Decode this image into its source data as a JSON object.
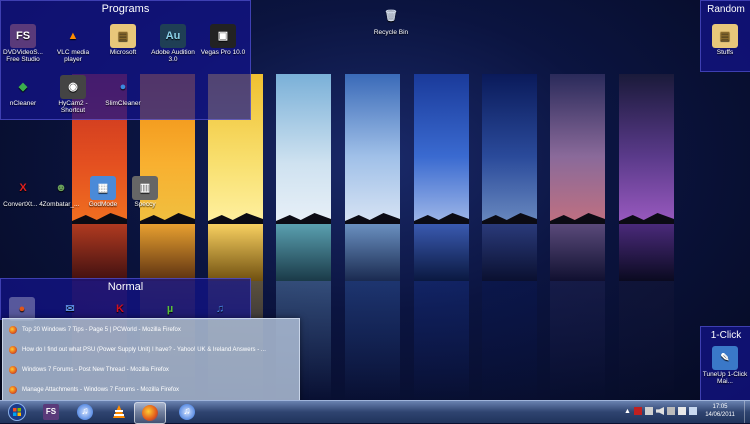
{
  "fences": {
    "programs": {
      "title": "Programs",
      "icons": [
        {
          "label": "DVDVideoS... Free Studio",
          "icon": "dvdvideosoft-icon",
          "glyph": "FS",
          "color": "#5a3a7a"
        },
        {
          "label": "VLC media player",
          "icon": "vlc-icon",
          "glyph": "▲",
          "color": "#ff8c00"
        },
        {
          "label": "Microsoft",
          "icon": "folder-icon",
          "glyph": "▤",
          "color": "#e8c77a"
        },
        {
          "label": "Adobe Audition 3.0",
          "icon": "audition-icon",
          "glyph": "Au",
          "color": "#1f3f55"
        },
        {
          "label": "Vegas Pro 10.0",
          "icon": "vegas-icon",
          "glyph": "▣",
          "color": "#222222"
        },
        {
          "label": "nCleaner",
          "icon": "ncleaner-icon",
          "glyph": "◆",
          "color": "#2e9a3e"
        },
        {
          "label": "HyCam2 - Shortcut",
          "icon": "hycam-icon",
          "glyph": "◉",
          "color": "#444444"
        },
        {
          "label": "SlimCleaner",
          "icon": "slimcleaner-icon",
          "glyph": "●",
          "color": "#2a7ad0"
        }
      ]
    },
    "random": {
      "title": "Random",
      "icons": [
        {
          "label": "Stuffs",
          "icon": "folder-icon",
          "glyph": "▤",
          "color": "#e8c77a"
        }
      ]
    },
    "normal": {
      "title": "Normal"
    },
    "oneclick": {
      "title": "1-Click",
      "icons": [
        {
          "label": "TuneUp 1-Click Mai...",
          "icon": "tuneup-icon",
          "glyph": "✎",
          "color": "#3a78c8"
        }
      ]
    }
  },
  "desktop_icons": [
    {
      "label": "Recycle Bin",
      "icon": "recycle-bin-icon",
      "glyph": "🗑",
      "color": "#cfd8e8"
    },
    {
      "label": "ConvertXt... 4",
      "icon": "convertx-icon",
      "glyph": "X",
      "color": "#c02020"
    },
    {
      "label": "Zombatar_...",
      "icon": "zombatar-icon",
      "glyph": "☻",
      "color": "#4a7a3a"
    },
    {
      "label": "GodMode",
      "icon": "godmode-icon",
      "glyph": "▦",
      "color": "#4a8ad8"
    },
    {
      "label": "Speccy",
      "icon": "speccy-icon",
      "glyph": "▥",
      "color": "#666666"
    }
  ],
  "normal_icons": [
    {
      "icon": "firefox-icon",
      "glyph": "●",
      "color": "#e0561b"
    },
    {
      "icon": "thunderbird-icon",
      "glyph": "✉",
      "color": "#2a5ab0"
    },
    {
      "icon": "kaspersky-icon",
      "glyph": "K",
      "color": "#d01020"
    },
    {
      "icon": "utorrent-icon",
      "glyph": "µ",
      "color": "#3a9a2a"
    },
    {
      "icon": "itunes-icon",
      "glyph": "♫",
      "color": "#2a6ad8"
    }
  ],
  "jumplist": [
    "Top 20 Windows 7 Tips - Page 5 | PCWorld - Mozilla Firefox",
    "How do I find out what PSU (Power Supply Unit) I have? - Yahoo! UK & Ireland Answers - ...",
    "Windows 7 Forums - Post New Thread - Mozilla Firefox",
    "Manage Attachments - Windows 7 Forums - Mozilla Firefox"
  ],
  "taskbar": {
    "items": [
      {
        "icon": "start-orb-icon",
        "active": false
      },
      {
        "icon": "dvdvideosoft-icon",
        "active": false
      },
      {
        "icon": "itunes-icon",
        "active": false
      },
      {
        "icon": "vlc-icon",
        "active": false
      },
      {
        "icon": "firefox-icon",
        "active": true
      },
      {
        "icon": "itunes-icon",
        "active": false
      }
    ],
    "time": "17:05",
    "date": "14/06/2011"
  },
  "colors": {
    "fence_bg": "#14148c",
    "taskbar": "#2f4470"
  }
}
